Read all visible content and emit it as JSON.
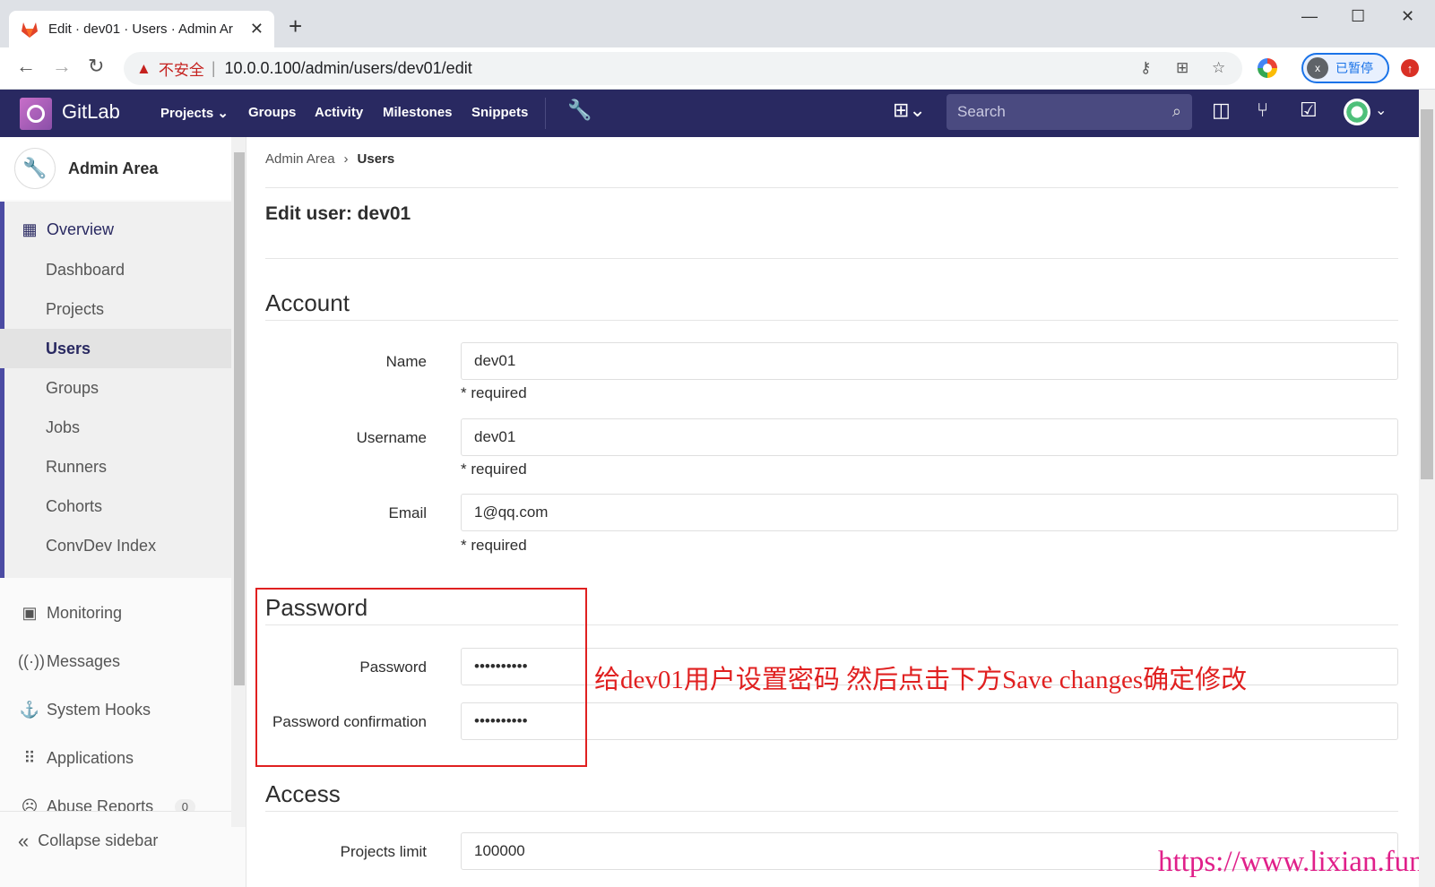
{
  "browser": {
    "tab_title": "Edit · dev01 · Users · Admin Ar",
    "insecure_label": "不安全",
    "url": "10.0.0.100/admin/users/dev01/edit",
    "profile_initial": "x",
    "profile_status": "已暂停"
  },
  "navbar": {
    "brand": "GitLab",
    "links": [
      "Projects",
      "Groups",
      "Activity",
      "Milestones",
      "Snippets"
    ],
    "search_placeholder": "Search"
  },
  "sidebar": {
    "title": "Admin Area",
    "overview": "Overview",
    "overview_items": [
      "Dashboard",
      "Projects",
      "Users",
      "Groups",
      "Jobs",
      "Runners",
      "Cohorts",
      "ConvDev Index"
    ],
    "active_item": "Users",
    "other_items": [
      {
        "label": "Monitoring",
        "icon": "monitor-icon"
      },
      {
        "label": "Messages",
        "icon": "broadcast-icon"
      },
      {
        "label": "System Hooks",
        "icon": "hook-icon"
      },
      {
        "label": "Applications",
        "icon": "grid-icon"
      },
      {
        "label": "Abuse Reports",
        "icon": "sad-face-icon",
        "badge": "0"
      }
    ],
    "collapse": "Collapse sidebar"
  },
  "main": {
    "breadcrumb": [
      "Admin Area",
      "Users"
    ],
    "page_title": "Edit user: dev01",
    "account": {
      "heading": "Account",
      "name_label": "Name",
      "name_value": "dev01",
      "username_label": "Username",
      "username_value": "dev01",
      "email_label": "Email",
      "email_value": "1@qq.com",
      "required": "* required"
    },
    "password": {
      "heading": "Password",
      "password_label": "Password",
      "password_value": "••••••••••",
      "confirm_label": "Password confirmation",
      "confirm_value": "••••••••••"
    },
    "access": {
      "heading": "Access",
      "projects_limit_label": "Projects limit",
      "projects_limit_value": "100000"
    }
  },
  "annotation": "给dev01用户设置密码 然后点击下方Save changes确定修改",
  "watermark": "https://www.lixian.fun",
  "colors": {
    "navbar": "#292961",
    "annotation": "#e02020",
    "watermark": "#e0208a"
  }
}
